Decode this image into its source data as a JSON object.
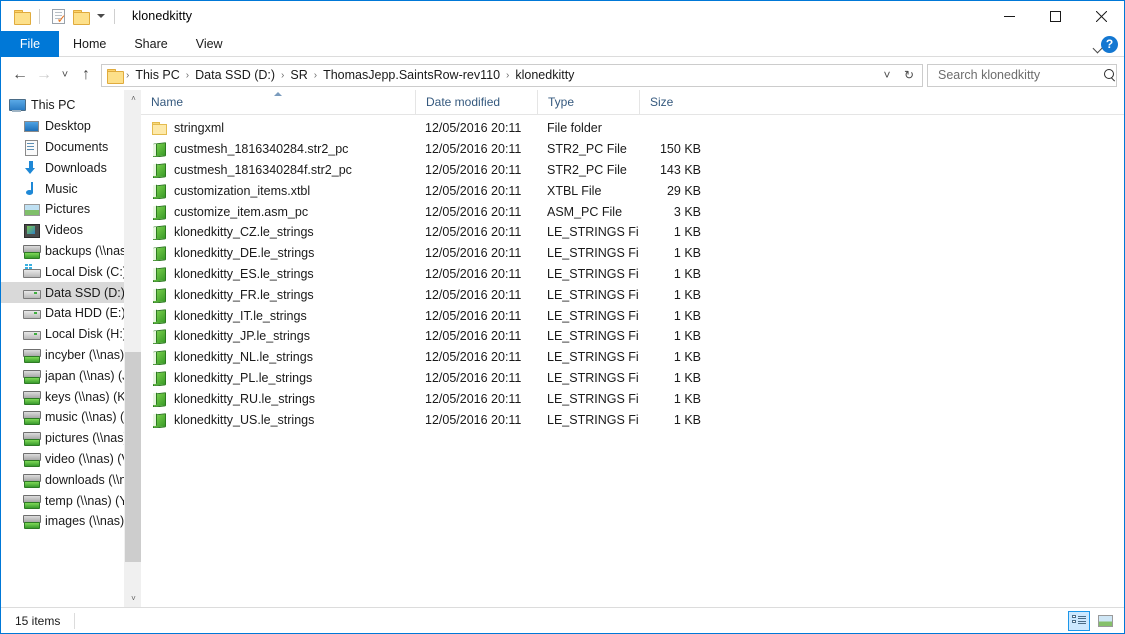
{
  "window": {
    "title": "klonedkitty",
    "quick_access": [
      {
        "name": "folder-properties",
        "icon": "folder-icon"
      },
      {
        "name": "properties",
        "icon": "properties-icon"
      },
      {
        "name": "new-folder",
        "icon": "folder-icon"
      },
      {
        "name": "customize",
        "icon": "chevron-down-icon"
      }
    ],
    "controls": {
      "minimize": "—",
      "maximize": "☐",
      "close": "✕"
    },
    "accent": "#0078d7"
  },
  "ribbon": {
    "tabs": [
      {
        "label": "File",
        "active": true
      },
      {
        "label": "Home",
        "active": false
      },
      {
        "label": "Share",
        "active": false
      },
      {
        "label": "View",
        "active": false
      }
    ],
    "expand_label": "˅",
    "help_label": "?"
  },
  "address": {
    "back": "←",
    "forward": "→",
    "recent": "˅",
    "up": "↑",
    "crumbs": [
      "This PC",
      "Data SSD (D:)",
      "SR",
      "ThomasJepp.SaintsRow-rev110",
      "klonedkitty"
    ],
    "separator": "›",
    "dropdown": "˅",
    "refresh": "↻"
  },
  "search": {
    "placeholder": "Search klonedkitty",
    "value": ""
  },
  "sidebar": {
    "items": [
      {
        "label": "This PC",
        "icon": "computer-icon",
        "level": "root",
        "selected": false
      },
      {
        "label": "Desktop",
        "icon": "desktop-icon",
        "level": "child",
        "selected": false
      },
      {
        "label": "Documents",
        "icon": "documents-icon",
        "level": "child",
        "selected": false
      },
      {
        "label": "Downloads",
        "icon": "downloads-icon",
        "level": "child",
        "selected": false
      },
      {
        "label": "Music",
        "icon": "music-icon",
        "level": "child",
        "selected": false
      },
      {
        "label": "Pictures",
        "icon": "pictures-icon",
        "level": "child",
        "selected": false
      },
      {
        "label": "Videos",
        "icon": "videos-icon",
        "level": "child",
        "selected": false
      },
      {
        "label": "backups (\\\\nas)",
        "icon": "network-drive-icon",
        "level": "child",
        "selected": false
      },
      {
        "label": "Local Disk (C:)",
        "icon": "windows-drive-icon",
        "level": "child",
        "selected": false
      },
      {
        "label": "Data SSD (D:)",
        "icon": "drive-icon",
        "level": "child",
        "selected": true
      },
      {
        "label": "Data HDD (E:)",
        "icon": "drive-icon",
        "level": "child",
        "selected": false
      },
      {
        "label": "Local Disk (H:)",
        "icon": "drive-icon",
        "level": "child",
        "selected": false
      },
      {
        "label": "incyber (\\\\nas) (",
        "icon": "network-drive-icon",
        "level": "child",
        "selected": false
      },
      {
        "label": "japan (\\\\nas) (J:)",
        "icon": "network-drive-icon",
        "level": "child",
        "selected": false
      },
      {
        "label": "keys (\\\\nas) (K:)",
        "icon": "network-drive-icon",
        "level": "child",
        "selected": false
      },
      {
        "label": "music (\\\\nas) (M",
        "icon": "network-drive-icon",
        "level": "child",
        "selected": false
      },
      {
        "label": "pictures (\\\\nas) (",
        "icon": "network-drive-icon",
        "level": "child",
        "selected": false
      },
      {
        "label": "video (\\\\nas) (V:",
        "icon": "network-drive-icon",
        "level": "child",
        "selected": false
      },
      {
        "label": "downloads (\\\\na",
        "icon": "network-drive-icon",
        "level": "child",
        "selected": false
      },
      {
        "label": "temp (\\\\nas) (Y:)",
        "icon": "network-drive-icon",
        "level": "child",
        "selected": false
      },
      {
        "label": "images (\\\\nas) (",
        "icon": "network-drive-icon",
        "level": "child",
        "selected": false
      }
    ],
    "scroll_up": "˄",
    "scroll_down": "˅"
  },
  "columns": [
    {
      "label": "Name",
      "sorted": "asc"
    },
    {
      "label": "Date modified",
      "sorted": ""
    },
    {
      "label": "Type",
      "sorted": ""
    },
    {
      "label": "Size",
      "sorted": ""
    }
  ],
  "files": [
    {
      "name": "stringxml",
      "date": "12/05/2016 20:11",
      "type": "File folder",
      "size": "",
      "icon": "folder-icon"
    },
    {
      "name": "custmesh_1816340284.str2_pc",
      "date": "12/05/2016 20:11",
      "type": "STR2_PC File",
      "size": "150 KB",
      "icon": "file-icon"
    },
    {
      "name": "custmesh_1816340284f.str2_pc",
      "date": "12/05/2016 20:11",
      "type": "STR2_PC File",
      "size": "143 KB",
      "icon": "file-icon"
    },
    {
      "name": "customization_items.xtbl",
      "date": "12/05/2016 20:11",
      "type": "XTBL File",
      "size": "29 KB",
      "icon": "file-icon"
    },
    {
      "name": "customize_item.asm_pc",
      "date": "12/05/2016 20:11",
      "type": "ASM_PC File",
      "size": "3 KB",
      "icon": "file-icon"
    },
    {
      "name": "klonedkitty_CZ.le_strings",
      "date": "12/05/2016 20:11",
      "type": "LE_STRINGS File",
      "size": "1 KB",
      "icon": "file-icon"
    },
    {
      "name": "klonedkitty_DE.le_strings",
      "date": "12/05/2016 20:11",
      "type": "LE_STRINGS File",
      "size": "1 KB",
      "icon": "file-icon"
    },
    {
      "name": "klonedkitty_ES.le_strings",
      "date": "12/05/2016 20:11",
      "type": "LE_STRINGS File",
      "size": "1 KB",
      "icon": "file-icon"
    },
    {
      "name": "klonedkitty_FR.le_strings",
      "date": "12/05/2016 20:11",
      "type": "LE_STRINGS File",
      "size": "1 KB",
      "icon": "file-icon"
    },
    {
      "name": "klonedkitty_IT.le_strings",
      "date": "12/05/2016 20:11",
      "type": "LE_STRINGS File",
      "size": "1 KB",
      "icon": "file-icon"
    },
    {
      "name": "klonedkitty_JP.le_strings",
      "date": "12/05/2016 20:11",
      "type": "LE_STRINGS File",
      "size": "1 KB",
      "icon": "file-icon"
    },
    {
      "name": "klonedkitty_NL.le_strings",
      "date": "12/05/2016 20:11",
      "type": "LE_STRINGS File",
      "size": "1 KB",
      "icon": "file-icon"
    },
    {
      "name": "klonedkitty_PL.le_strings",
      "date": "12/05/2016 20:11",
      "type": "LE_STRINGS File",
      "size": "1 KB",
      "icon": "file-icon"
    },
    {
      "name": "klonedkitty_RU.le_strings",
      "date": "12/05/2016 20:11",
      "type": "LE_STRINGS File",
      "size": "1 KB",
      "icon": "file-icon"
    },
    {
      "name": "klonedkitty_US.le_strings",
      "date": "12/05/2016 20:11",
      "type": "LE_STRINGS File",
      "size": "1 KB",
      "icon": "file-icon"
    }
  ],
  "status": {
    "item_count": "15 items",
    "views": [
      {
        "name": "details-view",
        "active": true
      },
      {
        "name": "large-icons-view",
        "active": false
      }
    ]
  }
}
